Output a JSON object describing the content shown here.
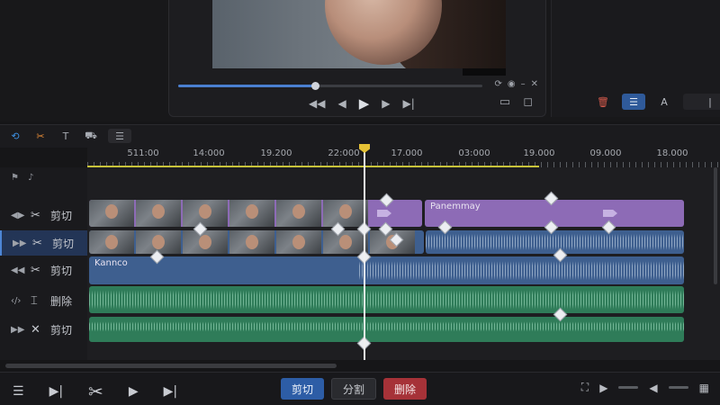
{
  "preview": {
    "progress": 0.45,
    "controls": [
      "rewind",
      "step-back",
      "play",
      "step-forward",
      "skip-end"
    ]
  },
  "ruler": {
    "ticks": [
      "511:00",
      "14:000",
      "19.200",
      "22:000",
      "17.000",
      "03:000",
      "19.000",
      "09.000",
      "18.000"
    ]
  },
  "tracks": [
    {
      "label": "剪切",
      "icon": "scissors-icon",
      "selected": false
    },
    {
      "label": "剪切",
      "icon": "scissors-icon",
      "selected": true
    },
    {
      "label": "剪切",
      "icon": "scissors-icon",
      "selected": false
    },
    {
      "label": "删除",
      "icon": "trim-icon",
      "selected": false
    },
    {
      "label": "剪切",
      "icon": "cross-icon",
      "selected": false
    }
  ],
  "clips": {
    "purple_name": "Panemmay",
    "blue_name": "Kannco"
  },
  "bottom": {
    "cut_label": "剪切",
    "split_label": "分割",
    "delete_label": "删除"
  },
  "colors": {
    "accent": "#2d5da6",
    "danger": "#a63238",
    "playhead_cap": "#e6c235",
    "video_clip": "#8d6bb6",
    "audio_clip": "#3e5f8f",
    "music_clip": "#2f7c59"
  }
}
